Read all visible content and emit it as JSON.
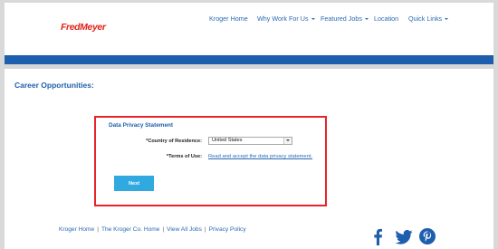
{
  "brand": {
    "logo_text": "FredMeyer"
  },
  "nav": {
    "items": [
      {
        "label": "Kroger Home",
        "dropdown": false
      },
      {
        "label": "Why Work For Us",
        "dropdown": true
      },
      {
        "label": "Featured Jobs",
        "dropdown": true
      },
      {
        "label": "Location",
        "dropdown": false
      },
      {
        "label": "Quick Links",
        "dropdown": true
      }
    ]
  },
  "page": {
    "title": "Career Opportunities:"
  },
  "dialog": {
    "title": "Data Privacy Statement",
    "country_label": "*Country of Residence:",
    "country_value": "United States",
    "terms_label": "*Terms of Use:",
    "terms_link": "Read and accept the data privacy statement.",
    "next_label": "Next"
  },
  "footer": {
    "links": [
      "Kroger Home",
      "The Kroger Co. Home",
      "View All Jobs",
      "Privacy Policy"
    ],
    "separator": "|",
    "social_icons": [
      "facebook-icon",
      "twitter-icon",
      "pinterest-icon"
    ]
  },
  "colors": {
    "brand_blue": "#1d5fae",
    "link_blue": "#2b69b3",
    "button_blue": "#2fa9e0",
    "highlight_red": "#e8232a",
    "logo_red": "#e2231a"
  }
}
